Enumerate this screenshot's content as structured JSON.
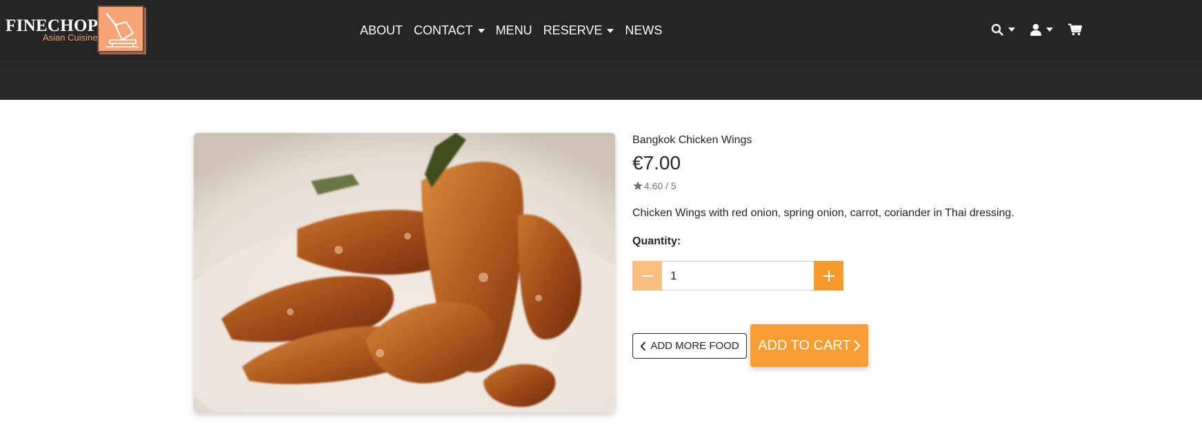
{
  "brand": {
    "name": "FINECHOP",
    "tagline": "Asian Cuisine"
  },
  "nav": {
    "items": [
      {
        "label": "ABOUT",
        "dropdown": false
      },
      {
        "label": "CONTACT",
        "dropdown": true
      },
      {
        "label": "MENU",
        "dropdown": false
      },
      {
        "label": "RESERVE",
        "dropdown": true
      },
      {
        "label": "NEWS",
        "dropdown": false
      }
    ]
  },
  "tools": {
    "search_icon": "search-icon",
    "account_icon": "user-icon",
    "cart_icon": "cart-icon"
  },
  "product": {
    "name": "Bangkok Chicken Wings",
    "price": "€7.00",
    "rating": "4.60 / 5",
    "description": "Chicken Wings with red onion, spring onion, carrot, coriander in Thai dressing.",
    "quantity_label": "Quantity:",
    "quantity_value": "1",
    "add_more_label": "ADD MORE FOOD",
    "add_to_cart_label": "ADD TO CART"
  },
  "colors": {
    "header_bg": "#252527",
    "accent": "#f79a2c",
    "accent_light": "#f8bf80",
    "brand_orange": "#f5a578"
  }
}
